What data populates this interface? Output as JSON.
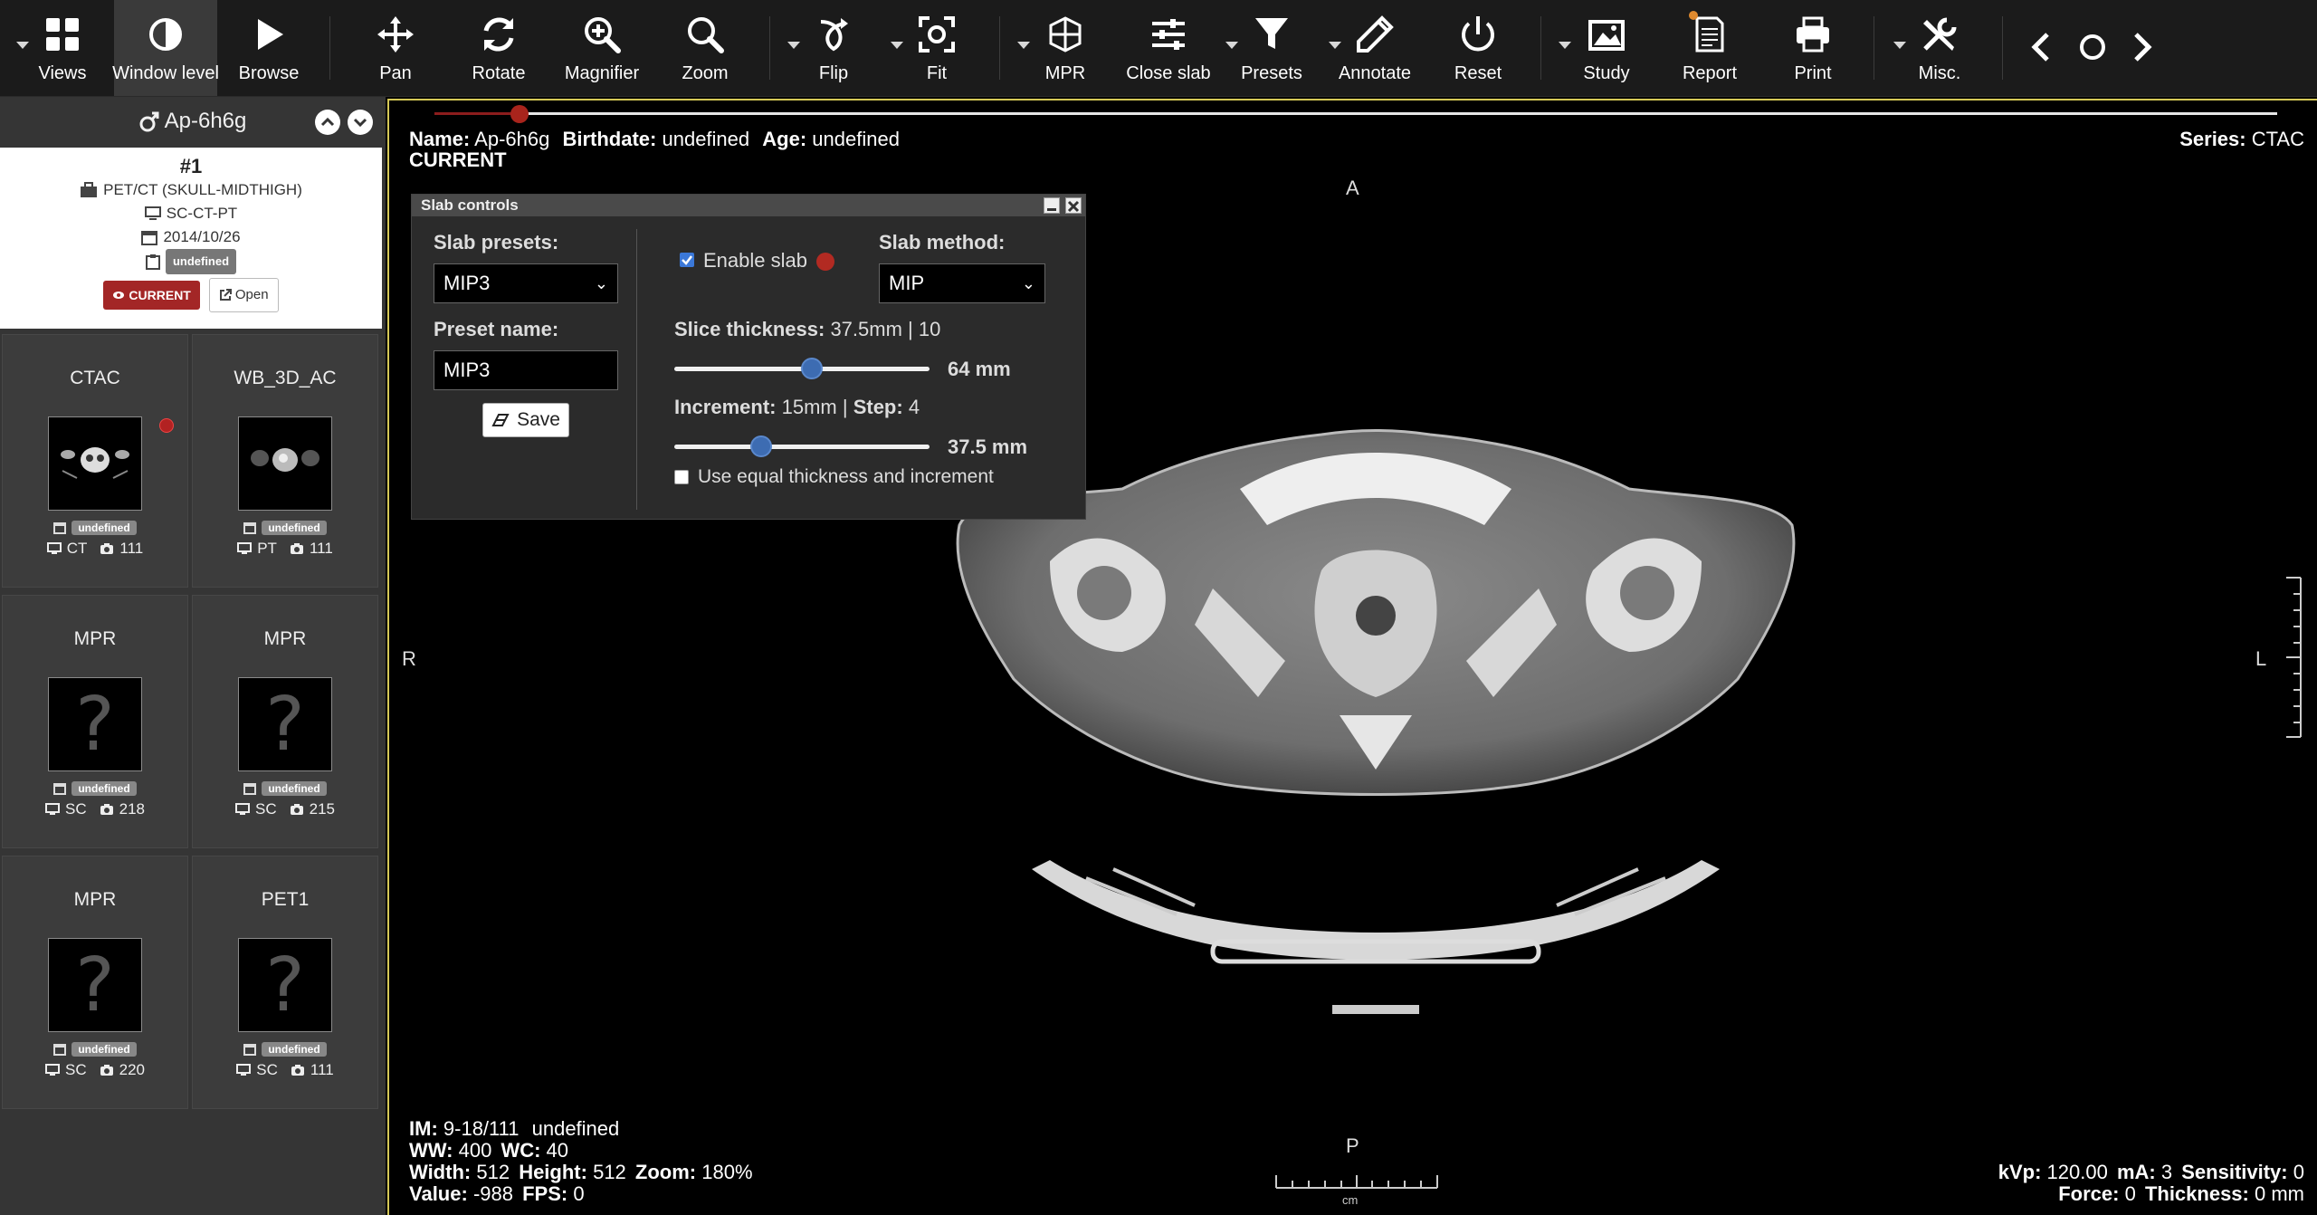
{
  "toolbar": {
    "tools": [
      {
        "id": "views",
        "label": "Views"
      },
      {
        "id": "window_level",
        "label": "Window level"
      },
      {
        "id": "browse",
        "label": "Browse"
      },
      {
        "id": "pan",
        "label": "Pan"
      },
      {
        "id": "rotate",
        "label": "Rotate"
      },
      {
        "id": "magnifier",
        "label": "Magnifier"
      },
      {
        "id": "zoom",
        "label": "Zoom"
      },
      {
        "id": "flip",
        "label": "Flip"
      },
      {
        "id": "fit",
        "label": "Fit"
      },
      {
        "id": "mpr",
        "label": "MPR"
      },
      {
        "id": "close_slab",
        "label": "Close slab"
      },
      {
        "id": "presets",
        "label": "Presets"
      },
      {
        "id": "annotate",
        "label": "Annotate"
      },
      {
        "id": "reset",
        "label": "Reset"
      },
      {
        "id": "study",
        "label": "Study"
      },
      {
        "id": "report",
        "label": "Report"
      },
      {
        "id": "print",
        "label": "Print"
      },
      {
        "id": "misc",
        "label": "Misc."
      }
    ],
    "active_tool": "window_level"
  },
  "sidebar": {
    "patient_name": "Ap-6h6g",
    "study": {
      "number": "#1",
      "description": "PET/CT (SKULL-MIDTHIGH)",
      "modalities": "SC-CT-PT",
      "date": "2014/10/26",
      "badge": "undefined",
      "current_label": "CURRENT",
      "open_label": "Open"
    },
    "series": [
      {
        "name": "CTAC",
        "date_badge": "undefined",
        "modality": "CT",
        "count": "111",
        "has_image": true,
        "has_dot": true
      },
      {
        "name": "WB_3D_AC",
        "date_badge": "undefined",
        "modality": "PT",
        "count": "111",
        "has_image": true,
        "has_dot": false
      },
      {
        "name": "MPR",
        "date_badge": "undefined",
        "modality": "SC",
        "count": "218",
        "has_image": false,
        "has_dot": false
      },
      {
        "name": "MPR",
        "date_badge": "undefined",
        "modality": "SC",
        "count": "215",
        "has_image": false,
        "has_dot": false
      },
      {
        "name": "MPR",
        "date_badge": "undefined",
        "modality": "SC",
        "count": "220",
        "has_image": false,
        "has_dot": false
      },
      {
        "name": "PET1",
        "date_badge": "undefined",
        "modality": "SC",
        "count": "111",
        "has_image": false,
        "has_dot": false
      }
    ],
    "placeholder_glyph": "?"
  },
  "viewer": {
    "top_left": {
      "name_label": "Name:",
      "name": "Ap-6h6g",
      "birth_label": "Birthdate:",
      "birth": "undefined",
      "age_label": "Age:",
      "age": "undefined",
      "status": "CURRENT"
    },
    "top_right": {
      "series_label": "Series:",
      "series": "CTAC"
    },
    "orientation": {
      "top": "A",
      "bottom": "P",
      "left": "R",
      "right": "L"
    },
    "bottom_left": {
      "im_label": "IM:",
      "im": "9-18/111",
      "im_extra": "undefined",
      "ww_label": "WW:",
      "ww": "400",
      "wc_label": "WC:",
      "wc": "40",
      "width_label": "Width:",
      "width": "512",
      "height_label": "Height:",
      "height": "512",
      "zoom_label": "Zoom:",
      "zoom": "180%",
      "value_label": "Value:",
      "value": "-988",
      "fps_label": "FPS:",
      "fps": "0"
    },
    "bottom_right": {
      "kvp_label": "kVp:",
      "kvp": "120.00",
      "ma_label": "mA:",
      "ma": "3",
      "sens_label": "Sensitivity:",
      "sens": "0",
      "force_label": "Force:",
      "force": "0",
      "thick_label": "Thickness:",
      "thick": "0 mm"
    },
    "scale_unit": "cm",
    "timeline_progress": 0.046
  },
  "slab_controls": {
    "title": "Slab controls",
    "presets_label": "Slab presets:",
    "preset_value": "MIP3",
    "preset_name_label": "Preset name:",
    "preset_name_value": "MIP3",
    "save_label": "Save",
    "enable_label": "Enable slab",
    "enable_checked": true,
    "method_label": "Slab method:",
    "method_value": "MIP",
    "thickness_label": "Slice thickness:",
    "thickness_info": "37.5mm | 10",
    "thickness_value": "64 mm",
    "thickness_slider": 0.54,
    "increment_label": "Increment:",
    "increment_info": "15mm |",
    "step_label": "Step:",
    "step_value": "4",
    "increment_value": "37.5 mm",
    "increment_slider": 0.34,
    "equal_label": "Use equal thickness and increment",
    "equal_checked": false
  },
  "colors": {
    "accent_border": "#d4c857",
    "current_badge": "#a32626",
    "slider_knob": "#3d6cb2",
    "timeline_fill": "#8c1d1d"
  }
}
